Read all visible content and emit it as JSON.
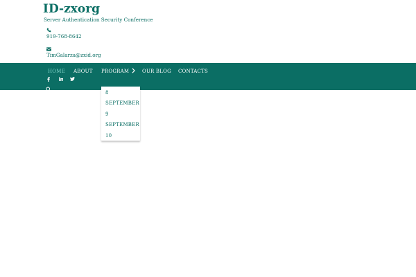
{
  "header": {
    "site_title": "ID-zxorg",
    "tagline": "Server Authentication Security Conference",
    "phone_icon": "phone-icon",
    "phone": "919-768-8642",
    "email_icon": "envelope-icon",
    "email": "TimGalarza@zxid.org"
  },
  "nav": {
    "items": [
      {
        "label": "HOME",
        "active": true
      },
      {
        "label": "ABOUT"
      },
      {
        "label": "PROGRAM",
        "icon": "chevron-right-icon"
      },
      {
        "label": "OUR BLOG"
      },
      {
        "label": "CONTACTS"
      }
    ],
    "social": [
      "facebook-icon",
      "linkedin-icon",
      "twitter-icon"
    ],
    "search_icon": "search-icon"
  },
  "program_dropdown": {
    "lines": [
      "8",
      "SEPTEMBER",
      "9",
      "SEPTEMBER",
      "10"
    ]
  },
  "colors": {
    "brand": "#0b6e64",
    "nav_active": "#7fd2c7",
    "nav_text": "#ffffff"
  }
}
